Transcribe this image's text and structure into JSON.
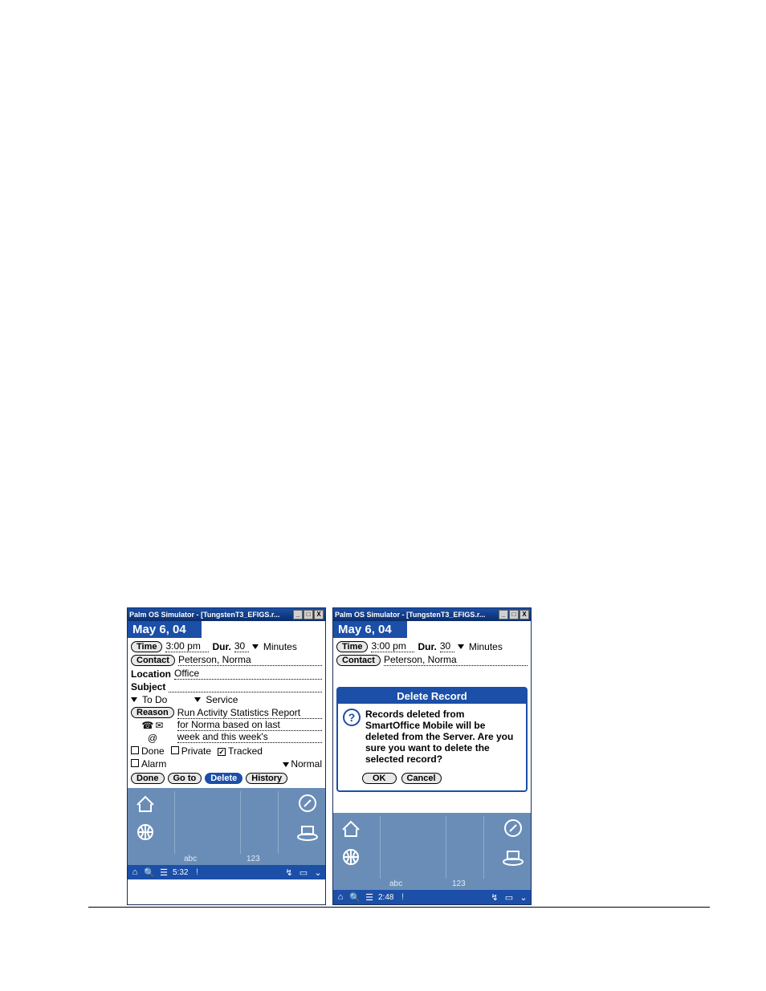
{
  "windowTitle": "Palm OS Simulator - [TungstenT3_EFIGS.r...",
  "leftScreen": {
    "date": "May 6, 04",
    "timeBtn": "Time",
    "timeVal": "3:00 pm",
    "durLabel": "Dur.",
    "durVal": "30",
    "durUnit": "Minutes",
    "contactBtn": "Contact",
    "contactVal": "Peterson, Norma",
    "locationLabel": "Location",
    "locationVal": "Office",
    "subjectLabel": "Subject",
    "typeDrop": "To Do",
    "serviceDrop": "Service",
    "reasonBtn": "Reason",
    "reasonLine1": "Run Activity Statistics Report",
    "reasonLine2": "for Norma based on last",
    "reasonLine3": "week and this week's",
    "at": "@",
    "chkDone": "Done",
    "chkPrivate": "Private",
    "chkTracked": "Tracked",
    "chkAlarm": "Alarm",
    "priorityDrop": "Normal",
    "btnDone": "Done",
    "btnGoto": "Go to",
    "btnDelete": "Delete",
    "btnHistory": "History",
    "silkAbc": "abc",
    "silk123": "123",
    "statusTime": "5:32"
  },
  "rightScreen": {
    "date": "May 6, 04",
    "timeBtn": "Time",
    "timeVal": "3:00 pm",
    "durLabel": "Dur.",
    "durVal": "30",
    "durUnit": "Minutes",
    "contactBtn": "Contact",
    "contactVal": "Peterson, Norma",
    "dialogTitle": "Delete Record",
    "dialogMsg": "Records deleted from SmartOffice Mobile will be deleted from the Server. Are you sure you want to delete the selected record?",
    "btnOk": "OK",
    "btnCancel": "Cancel",
    "silkAbc": "abc",
    "silk123": "123",
    "statusTime": "2:48"
  }
}
